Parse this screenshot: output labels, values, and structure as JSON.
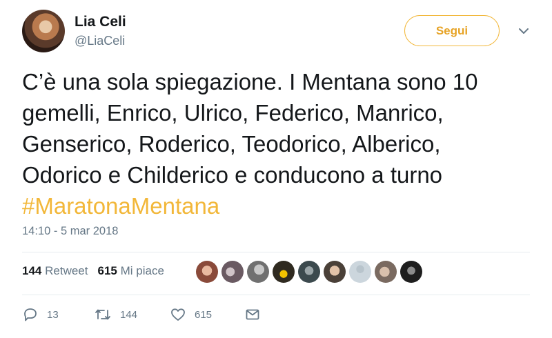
{
  "author": {
    "name": "Lia Celi",
    "handle": "@LiaCeli"
  },
  "follow_label": "Segui",
  "tweet": {
    "lines": [
      "C’è una sola spiegazione. I Mentana sono 10",
      "gemelli, Enrico, Ulrico, Federico, Manrico,",
      "Genserico, Roderico, Teodorico, Alberico,",
      "Odorico e Childerico e conducono a turno"
    ],
    "hashtag": "#MaratonaMentana",
    "timestamp": "14:10 - 5 mar 2018"
  },
  "stats": {
    "retweets": "144",
    "retweets_label": "Retweet",
    "likes": "615",
    "likes_label": "Mi piace"
  },
  "likers_count_shown": 9,
  "actions": {
    "replies": "13",
    "retweets": "144",
    "likes": "615"
  },
  "colors": {
    "accent": "#f2b739",
    "text": "#14171a",
    "secondary": "#657786",
    "divider": "#e6ecf0"
  },
  "icons": [
    "chevron-down-icon",
    "reply-icon",
    "retweet-icon",
    "heart-icon",
    "mail-icon"
  ]
}
